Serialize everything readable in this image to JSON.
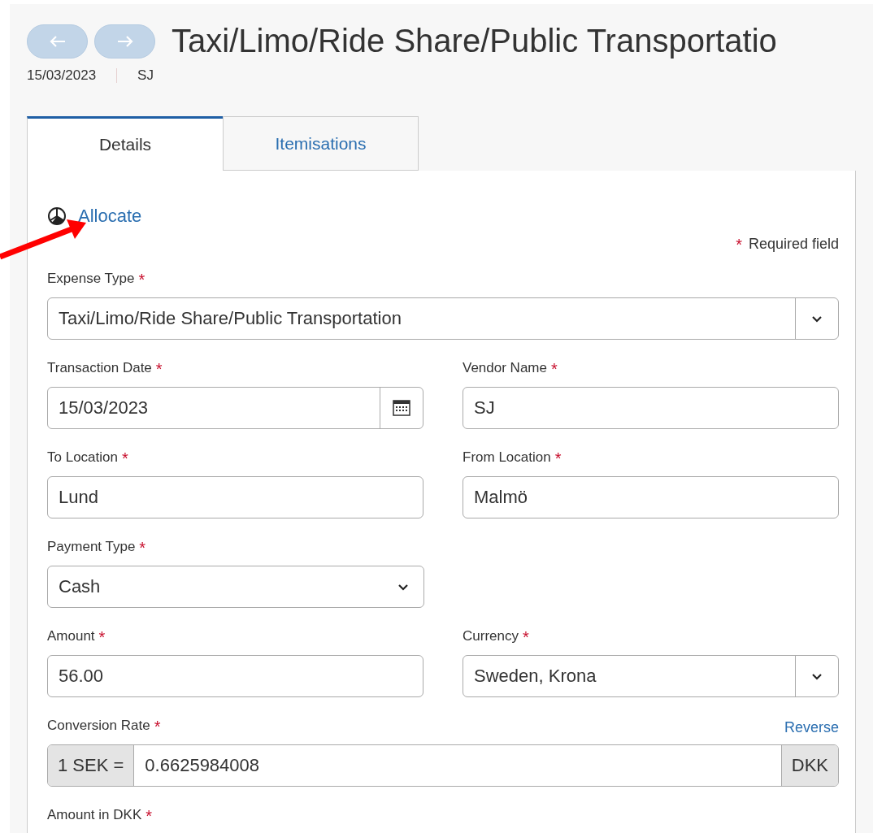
{
  "header": {
    "title": "Taxi/Limo/Ride Share/Public Transportatio",
    "date": "15/03/2023",
    "vendor": "SJ",
    "nav": [
      {
        "kind": "back",
        "disabled": true
      },
      {
        "kind": "forward",
        "disabled": true
      }
    ]
  },
  "tabs": [
    {
      "label": "Details",
      "selected": true
    },
    {
      "label": "Itemisations",
      "selected": false
    }
  ],
  "allocate": {
    "label": "Allocate"
  },
  "required_mark": "*",
  "required_note": "Required field",
  "rows": [
    {
      "fields": [
        {
          "label": "Expense Type",
          "required": true,
          "kind": "combo",
          "value": "Taxi/Limo/Ride Share/Public Transportation"
        }
      ]
    },
    {
      "fields": [
        {
          "label": "Transaction Date",
          "required": true,
          "kind": "date",
          "value": "15/03/2023"
        },
        {
          "label": "Vendor Name",
          "required": true,
          "kind": "text",
          "value": "SJ"
        }
      ]
    },
    {
      "fields": [
        {
          "label": "To Location",
          "required": true,
          "kind": "text",
          "value": "Lund"
        },
        {
          "label": "From Location",
          "required": true,
          "kind": "text",
          "value": "Malmö"
        }
      ]
    },
    {
      "fields": [
        {
          "label": "Payment Type",
          "required": true,
          "kind": "select",
          "value": "Cash"
        }
      ]
    },
    {
      "fields": [
        {
          "label": "Amount",
          "required": true,
          "kind": "text",
          "value": "56.00"
        },
        {
          "label": "Currency",
          "required": true,
          "kind": "combo",
          "value": "Sweden, Krona"
        }
      ]
    },
    {
      "fields": [
        {
          "label": "Conversion Rate",
          "required": true,
          "kind": "rate",
          "prefix": "1 SEK =",
          "value": "0.6625984008",
          "suffix": "DKK",
          "action": "Reverse"
        }
      ]
    },
    {
      "fields": [
        {
          "label": "Amount in DKK",
          "required": true,
          "kind": "label"
        }
      ]
    }
  ],
  "annotation": {
    "kind": "arrow"
  }
}
